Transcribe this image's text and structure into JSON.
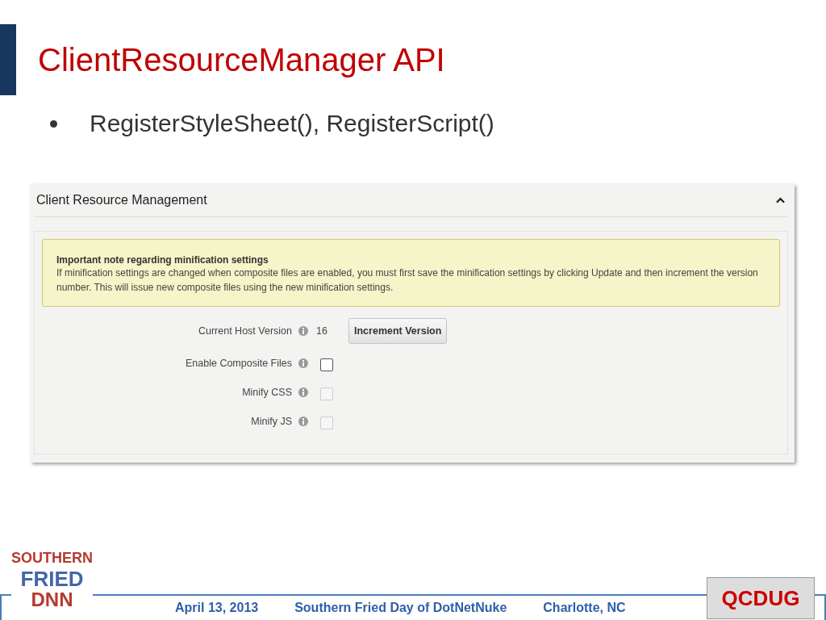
{
  "slide": {
    "title": "ClientResourceManager API",
    "bullets": [
      "RegisterStyleSheet(), RegisterScript()"
    ]
  },
  "panel": {
    "title": "Client Resource Management",
    "expanded": true,
    "note": {
      "heading": "Important note regarding minification settings",
      "text": "If minification settings are changed when composite files are enabled, you must first save the minification settings by clicking Update and then increment the version number. This will issue new composite files using the new minification settings."
    },
    "fields": [
      {
        "kind": "version",
        "label": "Current Host Version",
        "value": "16",
        "button": "Increment Version"
      },
      {
        "kind": "checkbox",
        "label": "Enable Composite Files",
        "checked": false,
        "disabled": false
      },
      {
        "kind": "checkbox",
        "label": "Minify CSS",
        "checked": false,
        "disabled": true
      },
      {
        "kind": "checkbox",
        "label": "Minify JS",
        "checked": false,
        "disabled": true
      }
    ]
  },
  "footer": {
    "logo_left": [
      "SOUTHERN",
      "FRIED",
      "DNN"
    ],
    "items": [
      "April 13, 2013",
      "Southern Fried Day of DotNetNuke",
      "Charlotte, NC"
    ],
    "logo_right": "QCDUG"
  }
}
